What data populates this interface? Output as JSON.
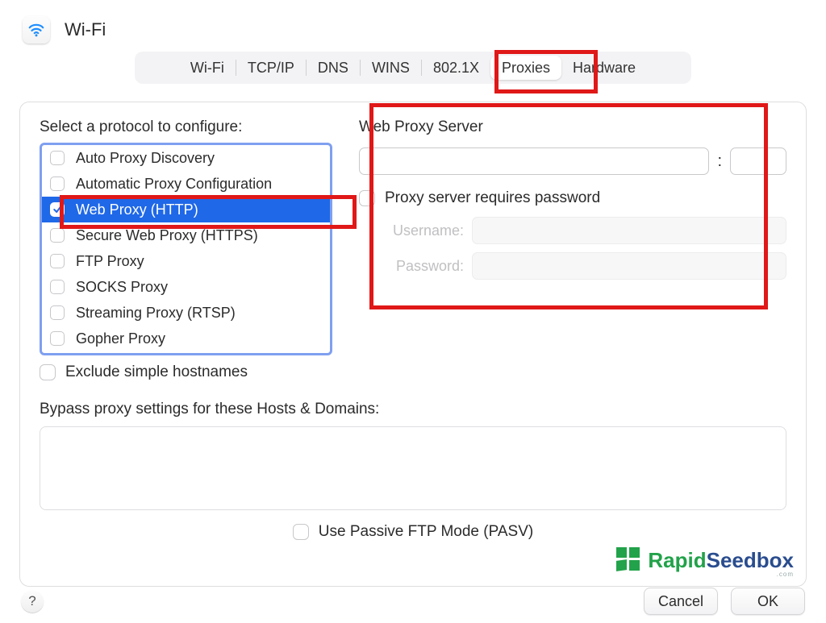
{
  "title": "Wi-Fi",
  "tabs": {
    "items": [
      "Wi-Fi",
      "TCP/IP",
      "DNS",
      "WINS",
      "802.1X",
      "Proxies",
      "Hardware"
    ],
    "active_index": 5
  },
  "left": {
    "section_label": "Select a protocol to configure:",
    "protocols": [
      {
        "label": "Auto Proxy Discovery",
        "checked": false,
        "selected": false
      },
      {
        "label": "Automatic Proxy Configuration",
        "checked": false,
        "selected": false
      },
      {
        "label": "Web Proxy (HTTP)",
        "checked": true,
        "selected": true
      },
      {
        "label": "Secure Web Proxy (HTTPS)",
        "checked": false,
        "selected": false
      },
      {
        "label": "FTP Proxy",
        "checked": false,
        "selected": false
      },
      {
        "label": "SOCKS Proxy",
        "checked": false,
        "selected": false
      },
      {
        "label": "Streaming Proxy (RTSP)",
        "checked": false,
        "selected": false
      },
      {
        "label": "Gopher Proxy",
        "checked": false,
        "selected": false
      }
    ],
    "exclude_simple_label": "Exclude simple hostnames"
  },
  "right": {
    "title": "Web Proxy Server",
    "host_value": "",
    "port_value": "",
    "colon": ":",
    "requires_password_label": "Proxy server requires password",
    "username_label": "Username:",
    "password_label": "Password:",
    "username_value": "",
    "password_value": ""
  },
  "bypass": {
    "label": "Bypass proxy settings for these Hosts & Domains:",
    "value": ""
  },
  "pasv_label": "Use Passive FTP Mode (PASV)",
  "footer": {
    "help": "?",
    "cancel": "Cancel",
    "ok": "OK"
  },
  "logo": {
    "rapid": "Rapid",
    "seedbox": "Seedbox",
    "sub": ".com"
  }
}
